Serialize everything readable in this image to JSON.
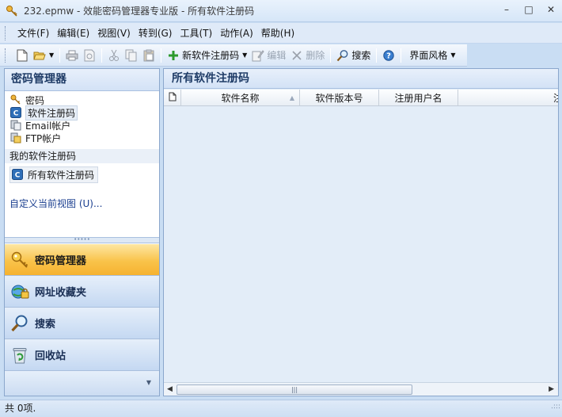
{
  "window": {
    "title": "232.epmw - 效能密码管理器专业版 - 所有软件注册码",
    "minimize_glyph": "–",
    "maximize_glyph": "□",
    "close_glyph": "✕"
  },
  "menu": {
    "items": [
      "文件(F)",
      "编辑(E)",
      "视图(V)",
      "转到(G)",
      "工具(T)",
      "动作(A)",
      "帮助(H)"
    ]
  },
  "toolbar": {
    "new_item_label": "新软件注册码",
    "edit_label": "编辑",
    "delete_label": "删除",
    "search_label": "搜索",
    "theme_label": "界面风格"
  },
  "left_panel": {
    "title": "密码管理器",
    "tree": [
      "密码",
      "软件注册码",
      "Email帐户",
      "FTP帐户"
    ],
    "group_heading": "我的软件注册码",
    "view_item": "所有软件注册码",
    "customize_link": "自定义当前视图 (U)...",
    "nav": [
      "密码管理器",
      "网址收藏夹",
      "搜索",
      "回收站"
    ],
    "splitter_glyph": "•••••",
    "footer_glyph": "▼"
  },
  "right_panel": {
    "title": "所有软件注册码",
    "columns": [
      "软件名称",
      "软件版本号",
      "注册用户名",
      "注册"
    ],
    "scroll_thumb_glyph": "|||",
    "scroll_left_glyph": "◀",
    "scroll_right_glyph": "▶"
  },
  "status": {
    "text": "共 0项.",
    "resize_glyph": ".:::"
  },
  "colors": {
    "accent": "#f9c34a",
    "pane_header_text": "#1e3b66",
    "link": "#1a3e8f"
  }
}
